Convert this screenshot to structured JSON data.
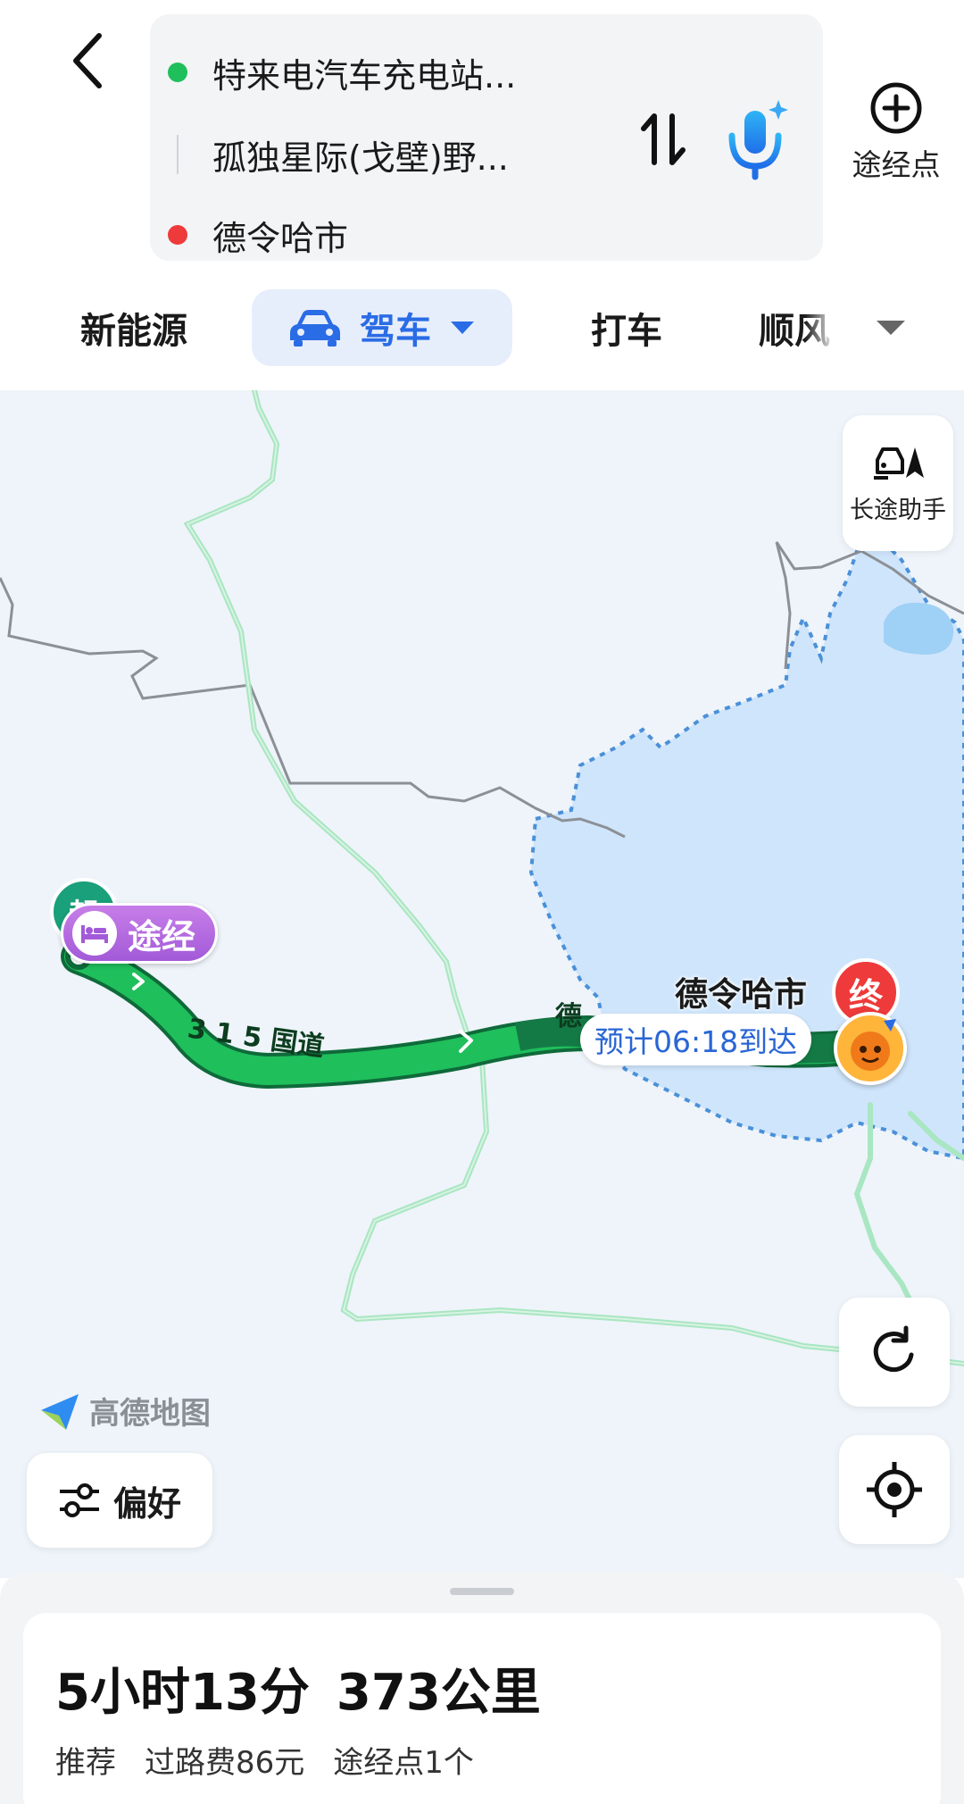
{
  "route": {
    "origin": "特来电汽车充电站...",
    "via": "孤独星际(戈壁)野...",
    "destination": "德令哈市"
  },
  "header": {
    "add_waypoint_label": "途经点"
  },
  "modes": {
    "items": [
      "新能源",
      "驾车",
      "打车",
      "顺风"
    ],
    "active": "驾车"
  },
  "map": {
    "long_trip_label": "长途助手",
    "city_label": "德令哈市",
    "eta_label": "预计06:18到达",
    "start_marker": "起",
    "end_marker": "终",
    "via_tag": "途经",
    "road_label_1": "3 1 5 国道",
    "road_label_2": "德",
    "logo_text": "高德地图",
    "preference_label": "偏好",
    "colors": {
      "route": "#1fbf5c",
      "route_dark": "#147a45",
      "region_fill": "#cfe5fb",
      "region_border": "#4a90d9",
      "highway": "#9de2b6",
      "boundary": "#8c9096",
      "water": "#9fd0f5"
    }
  },
  "summary": {
    "duration": "5小时13分",
    "distance": "373公里",
    "tag": "推荐",
    "toll": "过路费86元",
    "waypoints": "途经点1个"
  },
  "icons": {
    "back": "chevron-left-icon",
    "swap": "swap-vertical-icon",
    "voice": "microphone-icon",
    "add": "plus-circle-icon",
    "car": "car-icon",
    "dropdown": "caret-down-icon",
    "refresh": "refresh-icon",
    "locate": "locate-icon",
    "preference": "sliders-icon",
    "bed": "bed-icon"
  }
}
